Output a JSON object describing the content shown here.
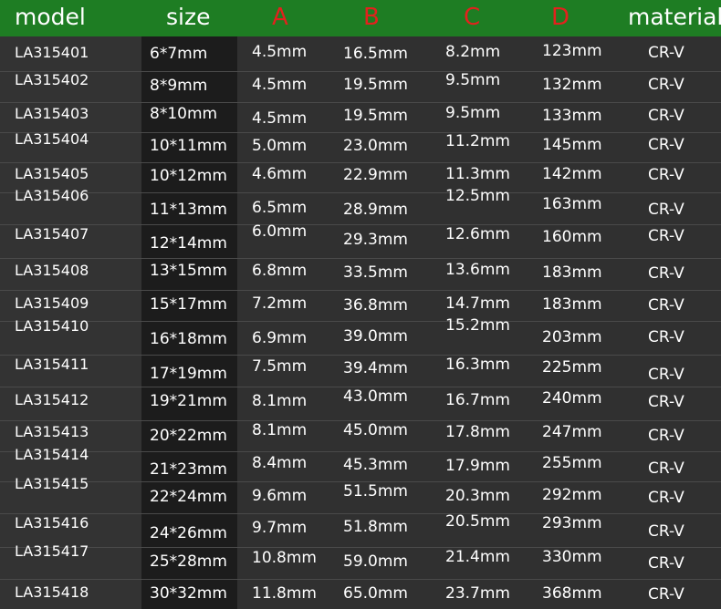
{
  "columns": [
    "model",
    "size",
    "A",
    "B",
    "C",
    "D",
    "material"
  ],
  "rows": [
    {
      "model": "LA315401",
      "size": "6*7mm",
      "A": "4.5mm",
      "B": "16.5mm",
      "C": "8.2mm",
      "D": "123mm",
      "material": "CR-V"
    },
    {
      "model": "LA315402",
      "size": "8*9mm",
      "A": "4.5mm",
      "B": "19.5mm",
      "C": "9.5mm",
      "D": "132mm",
      "material": "CR-V"
    },
    {
      "model": "LA315403",
      "size": "8*10mm",
      "A": "4.5mm",
      "B": "19.5mm",
      "C": "9.5mm",
      "D": "133mm",
      "material": "CR-V"
    },
    {
      "model": "LA315404",
      "size": "10*11mm",
      "A": "5.0mm",
      "B": "23.0mm",
      "C": "11.2mm",
      "D": "145mm",
      "material": "CR-V"
    },
    {
      "model": "LA315405",
      "size": "10*12mm",
      "A": "4.6mm",
      "B": "22.9mm",
      "C": "11.3mm",
      "D": "142mm",
      "material": "CR-V"
    },
    {
      "model": "LA315406",
      "size": "11*13mm",
      "A": "6.5mm",
      "B": "28.9mm",
      "C": "12.5mm",
      "D": "163mm",
      "material": "CR-V"
    },
    {
      "model": "LA315407",
      "size": "12*14mm",
      "A": "6.0mm",
      "B": "29.3mm",
      "C": "12.6mm",
      "D": "160mm",
      "material": "CR-V"
    },
    {
      "model": "LA315408",
      "size": "13*15mm",
      "A": "6.8mm",
      "B": "33.5mm",
      "C": "13.6mm",
      "D": "183mm",
      "material": "CR-V"
    },
    {
      "model": "LA315409",
      "size": "15*17mm",
      "A": "7.2mm",
      "B": "36.8mm",
      "C": "14.7mm",
      "D": "183mm",
      "material": "CR-V"
    },
    {
      "model": "LA315410",
      "size": "16*18mm",
      "A": "6.9mm",
      "B": "39.0mm",
      "C": "15.2mm",
      "D": "203mm",
      "material": "CR-V"
    },
    {
      "model": "LA315411",
      "size": "17*19mm",
      "A": "7.5mm",
      "B": "39.4mm",
      "C": "16.3mm",
      "D": "225mm",
      "material": "CR-V"
    },
    {
      "model": "LA315412",
      "size": "19*21mm",
      "A": "8.1mm",
      "B": "43.0mm",
      "C": "16.7mm",
      "D": "240mm",
      "material": "CR-V"
    },
    {
      "model": "LA315413",
      "size": "20*22mm",
      "A": "8.1mm",
      "B": "45.0mm",
      "C": "17.8mm",
      "D": "247mm",
      "material": "CR-V"
    },
    {
      "model": "LA315414",
      "size": "21*23mm",
      "A": "8.4mm",
      "B": "45.3mm",
      "C": "17.9mm",
      "D": "255mm",
      "material": "CR-V"
    },
    {
      "model": "LA315415",
      "size": "22*24mm",
      "A": "9.6mm",
      "B": "51.5mm",
      "C": "20.3mm",
      "D": "292mm",
      "material": "CR-V"
    },
    {
      "model": "LA315416",
      "size": "24*26mm",
      "A": "9.7mm",
      "B": "51.8mm",
      "C": "20.5mm",
      "D": "293mm",
      "material": "CR-V"
    },
    {
      "model": "LA315417",
      "size": "25*28mm",
      "A": "10.8mm",
      "B": "59.0mm",
      "C": "21.4mm",
      "D": "330mm",
      "material": "CR-V"
    },
    {
      "model": "LA315418",
      "size": "30*32mm",
      "A": "11.8mm",
      "B": "65.0mm",
      "C": "23.7mm",
      "D": "368mm",
      "material": "CR-V"
    }
  ],
  "colors": {
    "header_background": "#1e7d23",
    "header_text": "#ffffff",
    "dimension_header_text": "#e3211d",
    "body_background": "#303030",
    "size_column_background": "#1c1c1c",
    "body_text": "#ffffff"
  }
}
